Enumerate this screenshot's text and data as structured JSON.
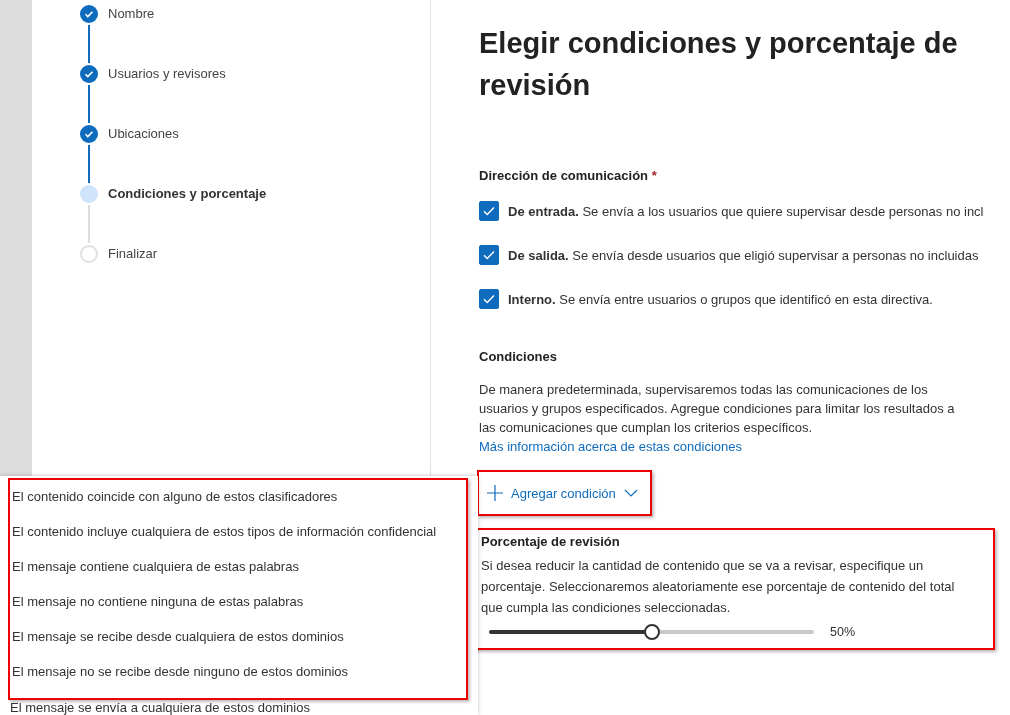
{
  "steps": [
    {
      "label": "Nombre",
      "done": true,
      "selected": false
    },
    {
      "label": "Usuarios y revisores",
      "done": true,
      "selected": false
    },
    {
      "label": "Ubicaciones",
      "done": true,
      "selected": false
    },
    {
      "label": "Condiciones y porcentaje",
      "done": false,
      "selected": true
    },
    {
      "label": "Finalizar",
      "done": false,
      "selected": false
    }
  ],
  "title": "Elegir condiciones y porcentaje de revisión",
  "direction": {
    "heading": "Dirección de comunicación",
    "required": "*",
    "options": [
      {
        "label": "De entrada.",
        "description": "Se envía a los usuarios que quiere supervisar desde personas no incl",
        "checked": true
      },
      {
        "label": "De salida.",
        "description": "Se envía desde usuarios que eligió supervisar a personas no incluidas",
        "checked": true
      },
      {
        "label": "Interno.",
        "description": "Se envía entre usuarios o grupos que identificó en esta directiva.",
        "checked": true
      }
    ]
  },
  "conditions": {
    "heading": "Condiciones",
    "text": "De manera predeterminada, supervisaremos todas las comunicaciones de los usuarios y grupos especificados. Agregue condiciones para limitar los resultados a las comunicaciones que cumplan los criterios específicos.",
    "link": "Más información acerca de estas condiciones",
    "add_button": "Agregar condición",
    "highlighted": true
  },
  "review": {
    "heading": "Porcentaje de revisión",
    "text": "Si desea reducir la cantidad de contenido que se va a revisar, especifique un porcentaje. Seleccionaremos aleatoriamente ese porcentaje de contenido del total que cumpla las condiciones seleccionadas.",
    "level": 0.5,
    "reading": "50%",
    "highlighted": true
  },
  "condition_menu": {
    "highlighted": true,
    "items": [
      "El contenido coincide con alguno de estos clasificadores",
      "El contenido incluye cualquiera de estos tipos de información confidencial",
      "El mensaje contiene cualquiera de estas palabras",
      "El mensaje no contiene ninguna de estas palabras",
      "El mensaje se recibe desde cualquiera de estos dominios",
      "El mensaje no se recibe desde ninguno de estos dominios"
    ],
    "more_item": "El mensaje se envía a cualquiera de estos dominios"
  }
}
